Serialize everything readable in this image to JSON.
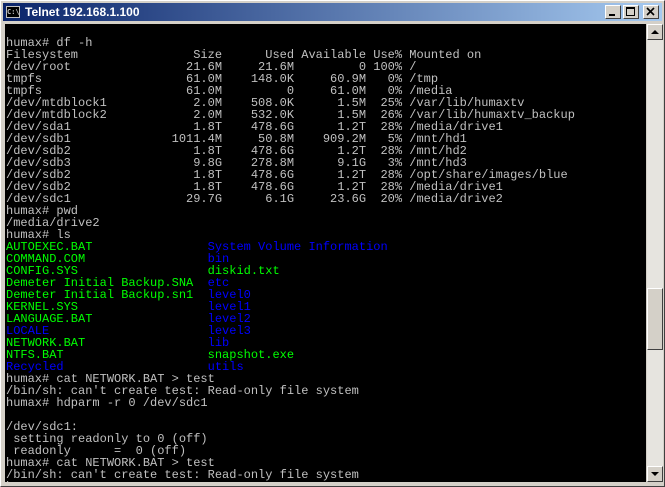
{
  "window": {
    "title": "Telnet 192.168.1.100",
    "icon": "console-icon",
    "controls": {
      "minimize": "_",
      "maximize": "□",
      "close": "×"
    }
  },
  "terminal": {
    "colors": {
      "default": "#c0c0c0",
      "executable": "#00ff00",
      "directory": "#0000ff",
      "background": "#000000"
    },
    "lines": [
      "humax# df -h",
      "Filesystem                Size      Used Available Use% Mounted on",
      "/dev/root                21.6M     21.6M         0 100% /",
      "tmpfs                    61.0M    148.0K     60.9M   0% /tmp",
      "tmpfs                    61.0M         0     61.0M   0% /media",
      "/dev/mtdblock1            2.0M    508.0K      1.5M  25% /var/lib/humaxtv",
      "/dev/mtdblock2            2.0M    532.0K      1.5M  26% /var/lib/humaxtv_backup",
      "/dev/sda1                 1.8T    478.6G      1.2T  28% /media/drive1",
      "/dev/sdb1              1011.4M     50.8M    909.2M   5% /mnt/hd1",
      "/dev/sdb2                 1.8T    478.6G      1.2T  28% /mnt/hd2",
      "/dev/sdb3                 9.8G    278.8M      9.1G   3% /mnt/hd3",
      "/dev/sdb2                 1.8T    478.6G      1.2T  28% /opt/share/images/blue",
      "/dev/sdb2                 1.8T    478.6G      1.2T  28% /media/drive1",
      "/dev/sdc1                29.7G      6.1G     23.6G  20% /media/drive2",
      "humax# pwd",
      "/media/drive2",
      "humax# ls"
    ],
    "ls_rows": [
      [
        {
          "name": "AUTOEXEC.BAT",
          "type": "g"
        },
        {
          "name": "System Volume Information",
          "type": "b"
        }
      ],
      [
        {
          "name": "COMMAND.COM",
          "type": "g"
        },
        {
          "name": "bin",
          "type": "b"
        }
      ],
      [
        {
          "name": "CONFIG.SYS",
          "type": "g"
        },
        {
          "name": "diskid.txt",
          "type": "g"
        }
      ],
      [
        {
          "name": "Demeter Initial Backup.SNA",
          "type": "g"
        },
        {
          "name": "etc",
          "type": "b"
        }
      ],
      [
        {
          "name": "Demeter Initial Backup.sn1",
          "type": "g"
        },
        {
          "name": "level0",
          "type": "b"
        }
      ],
      [
        {
          "name": "KERNEL.SYS",
          "type": "g"
        },
        {
          "name": "level1",
          "type": "b"
        }
      ],
      [
        {
          "name": "LANGUAGE.BAT",
          "type": "g"
        },
        {
          "name": "level2",
          "type": "b"
        }
      ],
      [
        {
          "name": "LOCALE",
          "type": "b"
        },
        {
          "name": "level3",
          "type": "b"
        }
      ],
      [
        {
          "name": "NETWORK.BAT",
          "type": "g"
        },
        {
          "name": "lib",
          "type": "b"
        }
      ],
      [
        {
          "name": "NTFS.BAT",
          "type": "g"
        },
        {
          "name": "snapshot.exe",
          "type": "g"
        }
      ],
      [
        {
          "name": "Recycled",
          "type": "b"
        },
        {
          "name": "utils",
          "type": "b"
        }
      ]
    ],
    "after_lines": [
      "humax# cat NETWORK.BAT > test",
      "/bin/sh: can't create test: Read-only file system",
      "humax# hdparm -r 0 /dev/sdc1",
      "",
      "/dev/sdc1:",
      " setting readonly to 0 (off)",
      " readonly      =  0 (off)",
      "humax# cat NETWORK.BAT > test",
      "/bin/sh: can't create test: Read-only file system"
    ],
    "prompt": "humax# "
  }
}
